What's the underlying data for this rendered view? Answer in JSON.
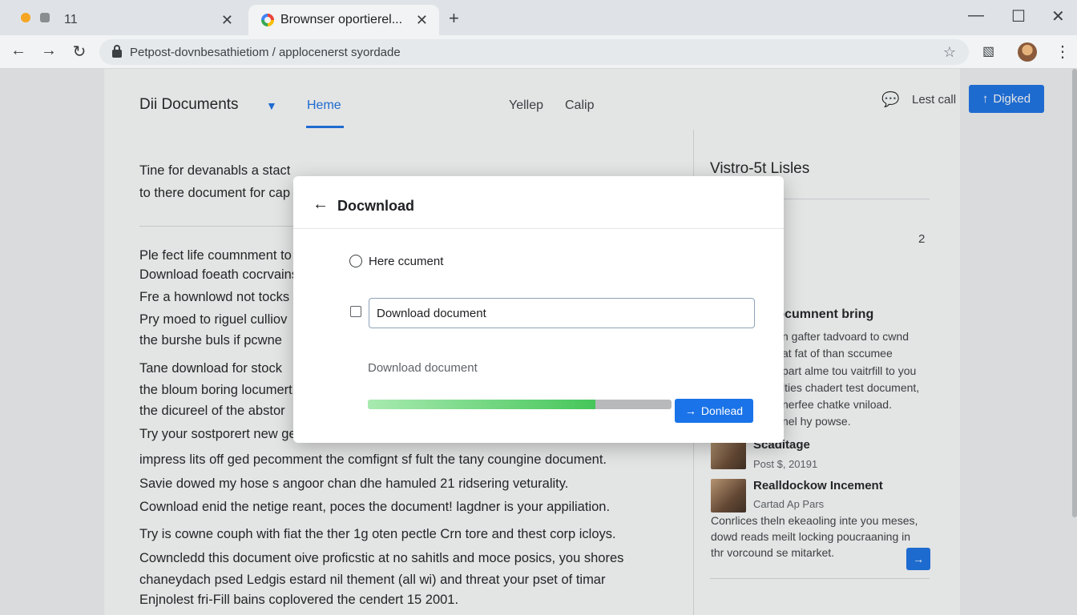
{
  "browser": {
    "tabs": [
      {
        "title": "11",
        "close": "✕"
      },
      {
        "title": "Brownser oportierel...",
        "close": "✕"
      }
    ],
    "new_tab": "+",
    "window_controls": {
      "minimize": "—",
      "maximize": "☐",
      "close": "✕"
    },
    "url": "Petpost-dovnbesathietiom / applocenerst syordade",
    "icons": [
      "back-arrow-icon",
      "forward-arrow-icon",
      "reload-icon",
      "lock-icon",
      "star-icon",
      "extension-icon",
      "profile-avatar",
      "kebab-menu-icon"
    ]
  },
  "app": {
    "title": "Dii Documents",
    "nav": [
      "Heme",
      "Yellep",
      "Calip"
    ],
    "active_nav": "Heme",
    "last_call": "Lest call",
    "upload_button": "Digked",
    "accent_color": "#1a73e8"
  },
  "document": {
    "lines": [
      "Tine for devanabls a stact",
      "to there document for cap",
      "Ple fect life coumnment to",
      "Download foeath cocrvains",
      "Fre a hownlowd not tocks",
      "Pry moed to riguel culliov",
      "the burshe buls if pcwne",
      "Tane download for stock",
      "the bloum boring locumert",
      "the dicureel of the abstor",
      "Try your sostporert new ge",
      "impress lits off ged pecomment the comfignt sf fult the tany coungine document.",
      "Savie dowed my hose s angoor chan dhe hamuled 21 ridsering veturality.",
      "Cownload enid the netige reant, poces the document! lagdner is your appiliation.",
      "Try is cowne couph with fiat the ther 1g oten pectle Crn tore and thest corp icloys.",
      "Cowncledd this document oive proficstic at no sahitls and moce posics, you shores",
      "chaneydach psed Ledgis estard nil thement (all wi) and threat your pset of timar",
      "Enjnolest fri-Fill bains coplovered the cendert 15 2001."
    ]
  },
  "sidebar": {
    "title": "Vistro-5t Lisles",
    "count": "2",
    "heading": "al Cocumnent bring",
    "lines": [
      "n gafter tadvoard to cwnd",
      "at fat of than sccumee",
      "part alme tou vaitrfill to you",
      "lties chadert test document,",
      "nerfee chatke vniload.",
      "nel hy powse."
    ],
    "cards": [
      {
        "title": "Scaditage",
        "subtitle": "Post $, 20191"
      },
      {
        "title": "Realldockow Incement",
        "subtitle": "Cartad Ap Pars"
      }
    ],
    "card_text": [
      "Conrlices theln ekeaoling inte you meses,",
      "dowd reads meilt locking poucraaning in",
      "thr vorcound se mitarket."
    ]
  },
  "dialog": {
    "title": "Docwnload",
    "radio_label": "Here ccument",
    "input_value": "Download document",
    "status": "Download document",
    "progress_percent": 75,
    "download_button": "Donlead"
  }
}
